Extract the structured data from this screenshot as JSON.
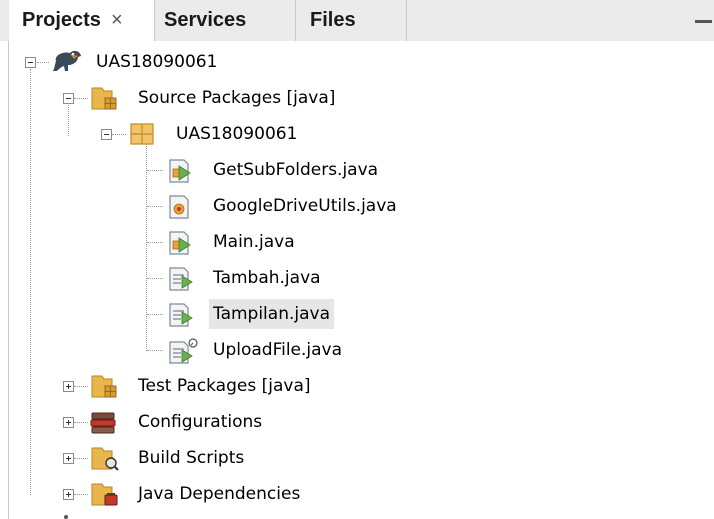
{
  "tabs": [
    {
      "label": "Projects",
      "close": "×"
    },
    {
      "label": "Services"
    },
    {
      "label": "Files"
    }
  ],
  "project": {
    "name": "UAS18090061",
    "source_packages": "Source Packages [java]",
    "package": "UAS18090061",
    "files": [
      "GetSubFolders.java",
      "GoogleDriveUtils.java",
      "Main.java",
      "Tambah.java",
      "Tampilan.java",
      "UploadFile.java"
    ],
    "test_packages": "Test Packages [java]",
    "configurations": "Configurations",
    "build_scripts": "Build Scripts",
    "java_dependencies": "Java Dependencies"
  },
  "selected_file": "Tampilan.java"
}
